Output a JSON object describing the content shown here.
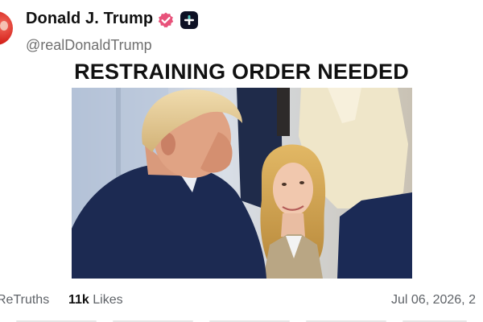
{
  "post": {
    "author": {
      "display_name": "Donald J. Trump",
      "handle": "@realDonaldTrump",
      "verified_icon": "verified-badge-icon",
      "extra_badge_icon": "plus-badge-icon",
      "verified_color": "#e8527a"
    },
    "text": "RESTRAINING ORDER NEEDED",
    "image": {
      "type": "photo"
    },
    "stats": {
      "retruths_count": "",
      "retruths_label": "ReTruths",
      "likes_count": "11k",
      "likes_label": "Likes"
    },
    "timestamp": "Jul 06, 2026, 2"
  }
}
